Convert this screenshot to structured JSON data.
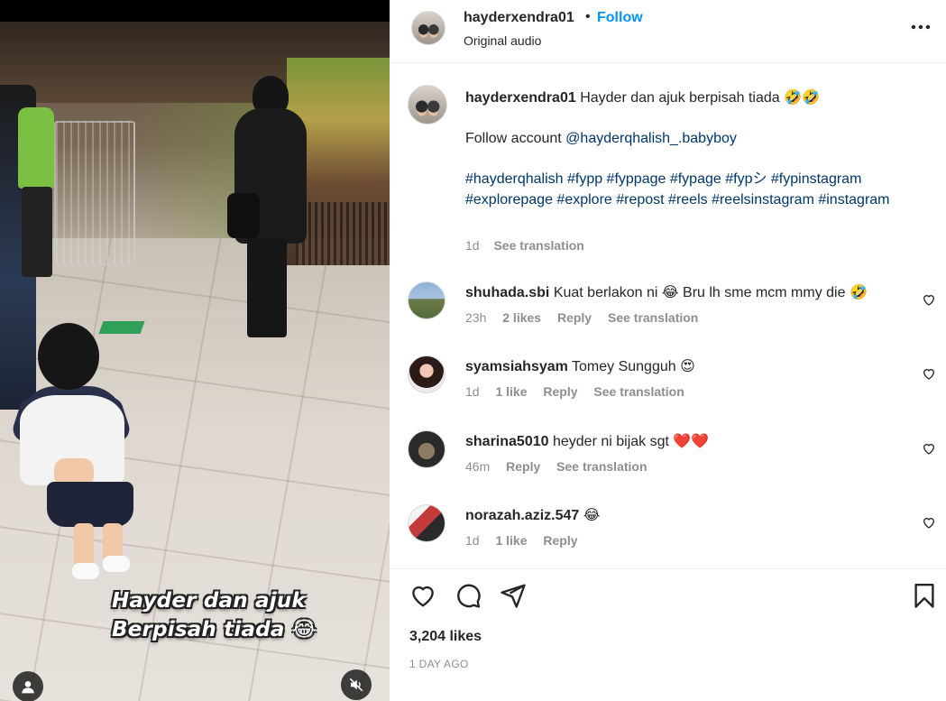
{
  "media": {
    "overlay_lines": [
      "Hayder dan ajuk",
      "Berpisah tiada 😂"
    ]
  },
  "header": {
    "username": "hayderxendra01",
    "dot": "•",
    "follow_label": "Follow",
    "audio": "Original audio"
  },
  "caption": {
    "username": "hayderxendra01",
    "text": "Hayder dan ajuk berpisah tiada 🤣🤣",
    "follow_prefix": "Follow account ",
    "mention": "@hayderqhalish_.babyboy",
    "hashtags": "#hayderqhalish #fypp #fyppage #fypage #fypシ #fypinstagram #explorepage #explore #repost #reels #reelsinstagram #instagram",
    "time": "1d",
    "translation": "See translation"
  },
  "comments": [
    {
      "username": "shuhada.sbi",
      "text": "Kuat berlakon ni 😂 Bru lh sme mcm mmy die 🤣",
      "time": "23h",
      "likes": "2 likes",
      "reply": "Reply",
      "translation": "See translation",
      "avatar": "castle"
    },
    {
      "username": "syamsiahsyam",
      "text": "Tomey Sungguh 😍",
      "time": "1d",
      "likes": "1 like",
      "reply": "Reply",
      "translation": "See translation",
      "avatar": "woman"
    },
    {
      "username": "sharina5010",
      "text": "heyder ni bijak sgt ❤️❤️",
      "time": "46m",
      "likes": "",
      "reply": "Reply",
      "translation": "See translation",
      "avatar": "dark"
    },
    {
      "username": "norazah.aziz.547",
      "text": "😂",
      "time": "1d",
      "likes": "1 like",
      "reply": "Reply",
      "translation": "",
      "avatar": "red"
    }
  ],
  "footer": {
    "likes": "3,204 likes",
    "ago": "1 DAY AGO"
  },
  "icons": {
    "more": "more-options-icon",
    "like": "heart-icon",
    "comment": "comment-icon",
    "share": "share-icon",
    "save": "bookmark-icon",
    "user": "user-icon",
    "mute": "mute-icon"
  },
  "colors": {
    "link_blue": "#0095f6",
    "hashtag": "#00376b",
    "muted": "#8e8e8e",
    "text": "#262626"
  }
}
